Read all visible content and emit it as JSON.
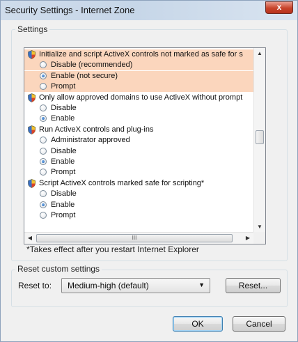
{
  "window": {
    "title": "Security Settings - Internet Zone",
    "close_label": "x"
  },
  "settings_group": {
    "legend": "Settings",
    "rows": [
      {
        "type": "category",
        "label": "Initialize and script ActiveX controls not marked as safe for s",
        "highlight": true
      },
      {
        "type": "option",
        "label": "Disable (recommended)",
        "checked": false,
        "highlight": true
      },
      {
        "type": "option",
        "label": "Enable (not secure)",
        "checked": true,
        "highlight": true
      },
      {
        "type": "option",
        "label": "Prompt",
        "checked": false,
        "highlight": true
      },
      {
        "type": "category",
        "label": "Only allow approved domains to use ActiveX without prompt",
        "highlight": false
      },
      {
        "type": "option",
        "label": "Disable",
        "checked": false,
        "highlight": false
      },
      {
        "type": "option",
        "label": "Enable",
        "checked": true,
        "highlight": false
      },
      {
        "type": "category",
        "label": "Run ActiveX controls and plug-ins",
        "highlight": false
      },
      {
        "type": "option",
        "label": "Administrator approved",
        "checked": false,
        "highlight": false
      },
      {
        "type": "option",
        "label": "Disable",
        "checked": false,
        "highlight": false
      },
      {
        "type": "option",
        "label": "Enable",
        "checked": true,
        "highlight": false
      },
      {
        "type": "option",
        "label": "Prompt",
        "checked": false,
        "highlight": false
      },
      {
        "type": "category",
        "label": "Script ActiveX controls marked safe for scripting*",
        "highlight": false
      },
      {
        "type": "option",
        "label": "Disable",
        "checked": false,
        "highlight": false
      },
      {
        "type": "option",
        "label": "Enable",
        "checked": true,
        "highlight": false
      },
      {
        "type": "option",
        "label": "Prompt",
        "checked": false,
        "highlight": false
      }
    ],
    "hscroll_grip": "III",
    "note": "*Takes effect after you restart Internet Explorer"
  },
  "reset_group": {
    "legend": "Reset custom settings",
    "reset_to_label": "Reset to:",
    "level_value": "Medium-high (default)",
    "reset_button": "Reset..."
  },
  "footer": {
    "ok_button": "OK",
    "cancel_button": "Cancel"
  },
  "colors": {
    "highlight": "#fbd6bd",
    "title_bar": "#cfdceb",
    "close_button": "#c7432a"
  }
}
